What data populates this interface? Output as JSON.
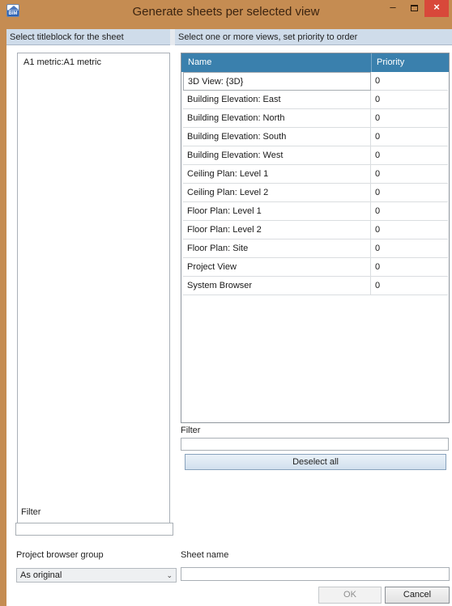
{
  "window": {
    "title": "Generate sheets per selected view",
    "minimize_glyph": "–",
    "close_glyph": "×",
    "icon_text": "BIM"
  },
  "left_panel": {
    "header": "Select titleblock for the sheet",
    "titleblocks": [
      "A1 metric:A1 metric"
    ],
    "filter_label": "Filter",
    "filter_value": ""
  },
  "right_panel": {
    "header": "Select one or more views, set priority to order",
    "columns": {
      "name": "Name",
      "priority": "Priority"
    },
    "rows": [
      {
        "name": "3D View: {3D}",
        "priority": "0"
      },
      {
        "name": "Building Elevation: East",
        "priority": "0"
      },
      {
        "name": "Building Elevation: North",
        "priority": "0"
      },
      {
        "name": "Building Elevation: South",
        "priority": "0"
      },
      {
        "name": "Building Elevation: West",
        "priority": "0"
      },
      {
        "name": "Ceiling Plan: Level 1",
        "priority": "0"
      },
      {
        "name": "Ceiling Plan: Level 2",
        "priority": "0"
      },
      {
        "name": "Floor Plan: Level 1",
        "priority": "0"
      },
      {
        "name": "Floor Plan: Level 2",
        "priority": "0"
      },
      {
        "name": "Floor Plan: Site",
        "priority": "0"
      },
      {
        "name": "Project View",
        "priority": "0"
      },
      {
        "name": "System Browser",
        "priority": "0"
      }
    ],
    "filter_label": "Filter",
    "filter_value": "",
    "deselect_label": "Deselect all"
  },
  "bottom": {
    "group_label": "Project browser group",
    "group_value": "As original",
    "sheet_name_label": "Sheet name",
    "sheet_name_value": "",
    "ok_label": "OK",
    "cancel_label": "Cancel"
  },
  "colors": {
    "frame": "#c58c52",
    "grid_header": "#3a80ad",
    "section_header": "#cfdcea",
    "close_button": "#d8483a"
  }
}
